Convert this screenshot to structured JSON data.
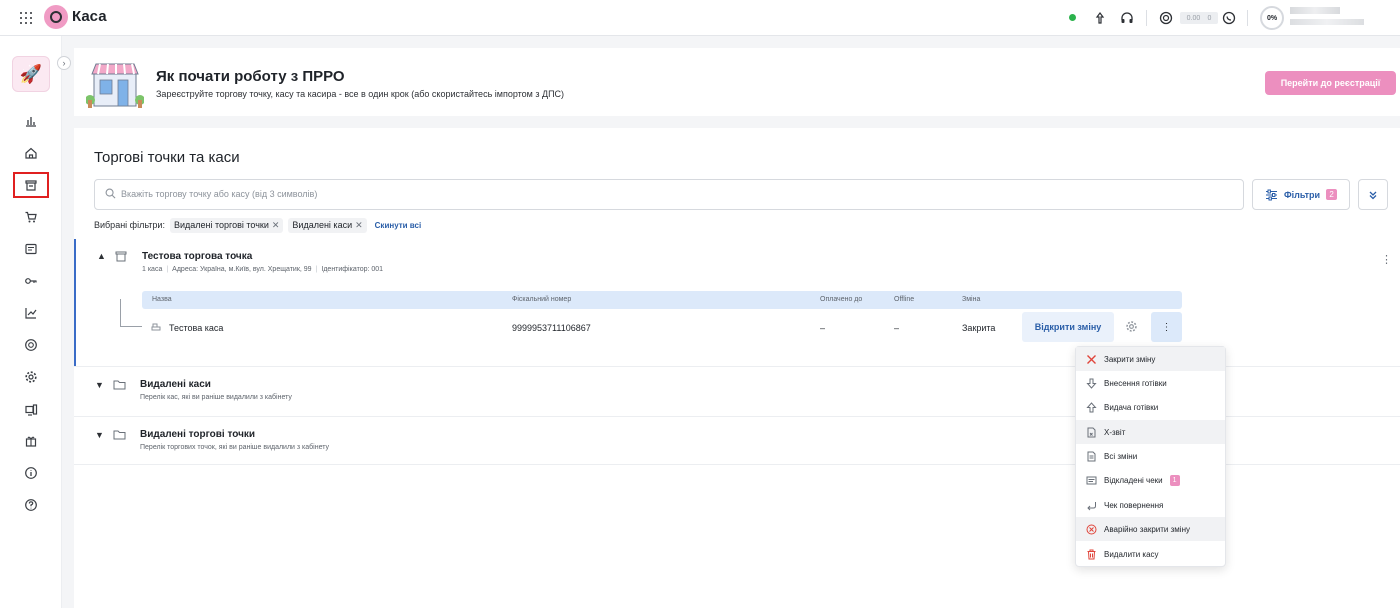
{
  "app": {
    "title": "Каса"
  },
  "topbar": {
    "balance": {
      "value": "0.00",
      "count": "0"
    },
    "progress": "0%"
  },
  "banner": {
    "title": "Як почати роботу з ПРРО",
    "subtitle": "Зареєструйте торгову точку, касу та касира - все в один крок (або скористайтесь імпортом з ДПС)",
    "button": "Перейти до реєстрації"
  },
  "page": {
    "title": "Торгові точки та каси",
    "search_placeholder": "Вкажіть торгову точку або касу (від 3 символів)",
    "filters_label": "Фільтри",
    "filters_count": "2",
    "chosen_label": "Вибрані фільтри:",
    "chips": [
      "Видалені торгові точки",
      "Видалені каси"
    ],
    "reset_label": "Скинути всі"
  },
  "store": {
    "name": "Тестова торгова точка",
    "count": "1 каса",
    "address": "Адреса: Україна, м.Київ, вул. Хрещатик, 99",
    "id": "Ідентифікатор: 001",
    "columns": {
      "name": "Назва",
      "fiscal": "Фіскальний номер",
      "paid": "Оплачено до",
      "offline": "Offline",
      "shift": "Зміна"
    },
    "row": {
      "name": "Тестова каса",
      "fiscal": "9999953711106867",
      "paid": "–",
      "offline": "–",
      "shift": "Закрита",
      "action": "Відкрити зміну"
    }
  },
  "deleted_cash": {
    "title": "Видалені каси",
    "subtitle": "Перелік кас, які ви раніше видалили з кабінету"
  },
  "deleted_points": {
    "title": "Видалені торгові точки",
    "subtitle": "Перелік торгових точок, які ви раніше видалили з кабінету"
  },
  "menu": {
    "items": [
      {
        "label": "Закрити зміну",
        "icon": "close-x-icon"
      },
      {
        "label": "Внесення готівки",
        "icon": "arrow-down-icon"
      },
      {
        "label": "Видача готівки",
        "icon": "arrow-up-icon"
      },
      {
        "label": "Х-звіт",
        "icon": "document-icon"
      },
      {
        "label": "Всі зміни",
        "icon": "document-list-icon"
      },
      {
        "label": "Відкладені чеки",
        "icon": "receipt-icon",
        "badge": "1"
      },
      {
        "label": "Чек повернення",
        "icon": "return-icon"
      },
      {
        "label": "Аварійно закрити зміну",
        "icon": "circle-x-icon"
      },
      {
        "label": "Видалити касу",
        "icon": "trash-icon"
      }
    ]
  },
  "colors": {
    "accent_pink": "#ec8fbf",
    "link_blue": "#2a5ea8",
    "active_border": "#e02020",
    "online_green": "#2bb24c"
  }
}
